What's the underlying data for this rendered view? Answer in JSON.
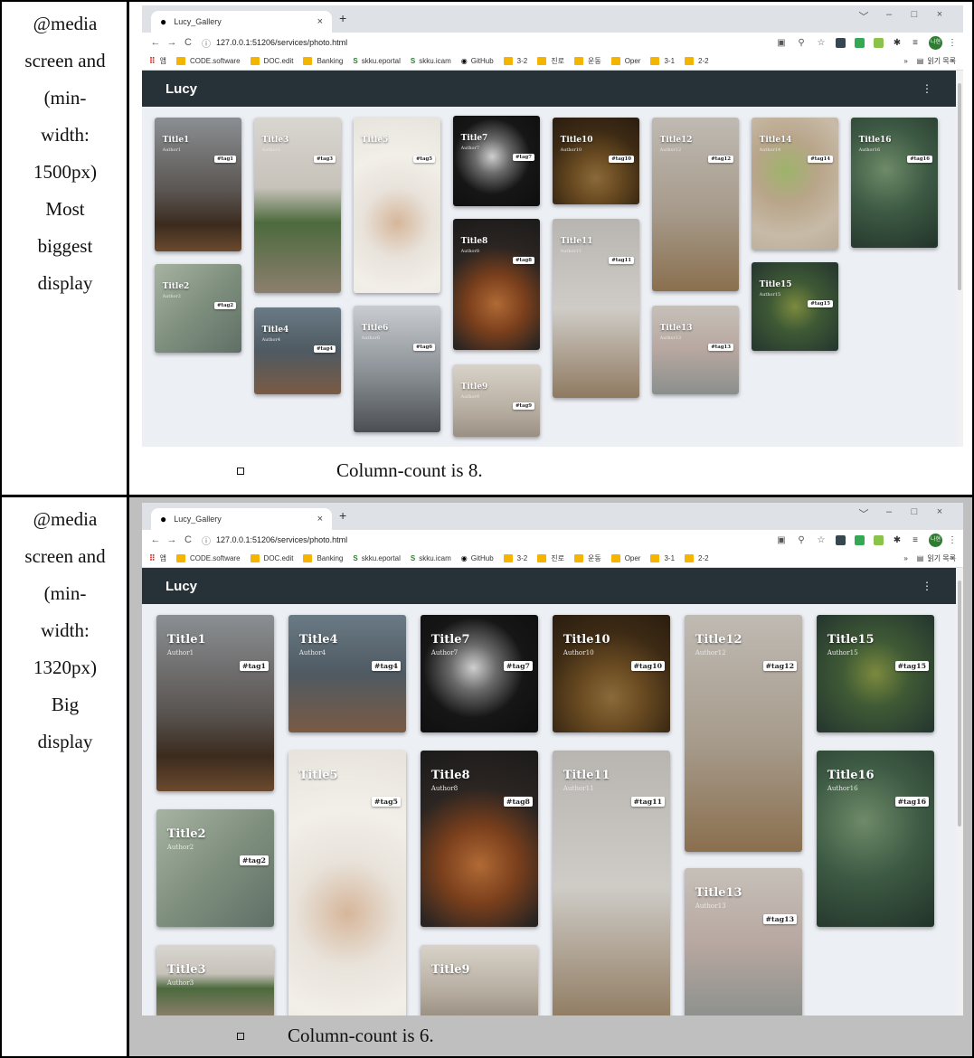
{
  "rows": [
    {
      "left_lines": [
        "@media",
        "screen and",
        "(min-",
        "width:",
        "1500px)",
        "Most",
        "biggest",
        "display"
      ],
      "caption": "Column-count is 8."
    },
    {
      "left_lines": [
        "@media",
        "screen and",
        "(min-",
        "width:",
        "1320px)",
        "Big",
        "display"
      ],
      "caption": "Column-count is 6."
    }
  ],
  "browser": {
    "tab_title": "Lucy_Gallery",
    "tab_close": "×",
    "new_tab": "+",
    "url": "127.0.0.1:51206/services/photo.html",
    "window_controls": [
      "﹀",
      "–",
      "□",
      "×"
    ],
    "bookmarks": [
      {
        "label": "앱",
        "type": "apps"
      },
      {
        "label": "CODE.software",
        "type": "folder"
      },
      {
        "label": "DOC.edit",
        "type": "folder"
      },
      {
        "label": "Banking",
        "type": "folder"
      },
      {
        "label": "skku.eportal",
        "type": "site"
      },
      {
        "label": "skku.icam",
        "type": "site"
      },
      {
        "label": "GitHub",
        "type": "github"
      },
      {
        "label": "3-2",
        "type": "folder"
      },
      {
        "label": "진로",
        "type": "folder"
      },
      {
        "label": "운동",
        "type": "folder"
      },
      {
        "label": "Oper",
        "type": "folder"
      },
      {
        "label": "3-1",
        "type": "folder"
      },
      {
        "label": "2-2",
        "type": "folder"
      }
    ],
    "bookmarks_more": "»",
    "reading_list": "읽기 목록",
    "profile": "나현",
    "app_brand": "Lucy",
    "app_menu": "⋮"
  },
  "colors": {
    "appbar": "#263238",
    "gallery_bg": "#eceff4",
    "folder": "#f4b400",
    "profile": "#2e7d32",
    "second_row_bg": "#bfbfbf"
  },
  "cards_top": [
    {
      "title": "Title1",
      "author": "Author1",
      "tag": "#tag1",
      "bg": "linear-gradient(180deg,#8b8f93 0%,#5a5552 55%,#3b2b1e 80%,#6b4a2e 100%)"
    },
    {
      "title": "Title2",
      "author": "Author2",
      "tag": "#tag2",
      "bg": "linear-gradient(135deg,#a7b3a2 0%,#7f8f7e 50%,#5f6f66 100%)"
    },
    {
      "title": "Title3",
      "author": "Author3",
      "tag": "#tag3",
      "bg": "linear-gradient(180deg,#d9d6d0 0%,#c7c2ba 40%,#4c6a3d 60%,#8c7f6e 100%)"
    },
    {
      "title": "Title4",
      "author": "Author4",
      "tag": "#tag4",
      "bg": "linear-gradient(180deg,#6a7a86 0%,#4f5a62 50%,#7a5a44 100%)"
    },
    {
      "title": "Title5",
      "author": "Author5",
      "tag": "#tag5",
      "bg": "radial-gradient(circle at 50% 60%,#d6b69a 0%,#e8e2da 30%,#f2efe9 60%,#e7e3dc 100%)"
    },
    {
      "title": "Title6",
      "author": "Author6",
      "tag": "#tag6",
      "bg": "linear-gradient(180deg,#c9ccd0 0%,#8e9499 50%,#4c4f52 100%)"
    },
    {
      "title": "Title7",
      "author": "Author7",
      "tag": "#tag7",
      "bg": "radial-gradient(circle at 45% 45%,#cfcfcf 0%,#6b6b6b 25%,#161616 55%,#0e0e0e 100%)"
    },
    {
      "title": "Title8",
      "author": "Author8",
      "tag": "#tag8",
      "bg": "radial-gradient(circle at 50% 65%,#b06a35 0%,#7a3f1c 30%,#2b2522 60%,#1b1a1a 100%)"
    },
    {
      "title": "Title9",
      "author": "Author9",
      "tag": "#tag9",
      "bg": "linear-gradient(180deg,#d8d2c8 0%,#b9b0a4 60%,#9a8f82 100%)"
    },
    {
      "title": "Title10",
      "author": "Author10",
      "tag": "#tag10",
      "bg": "radial-gradient(circle at 50% 70%,#8a6a3a 0%,#6b4c22 30%,#3c2a14 65%,#2a1d10 100%)"
    },
    {
      "title": "Title11",
      "author": "Author11",
      "tag": "#tag11",
      "bg": "linear-gradient(180deg,#b8b5b1 0%,#cfccc7 50%,#8f7a60 100%)"
    },
    {
      "title": "Title12",
      "author": "Author12",
      "tag": "#tag12",
      "bg": "linear-gradient(180deg,#bfbab3 0%,#a69a8a 55%,#8a6f4e 100%)"
    },
    {
      "title": "Title13",
      "author": "Author13",
      "tag": "#tag13",
      "bg": "linear-gradient(180deg,#c6c0b9 0%,#b7a7a0 50%,#8a8f8c 100%)"
    },
    {
      "title": "Title14",
      "author": "Author14",
      "tag": "#tag14",
      "bg": "radial-gradient(circle at 40% 40%,#9db36a 0%,#b9a58a 35%,#c7bba8 70%,#b9ad99 100%)"
    },
    {
      "title": "Title15",
      "author": "Author15",
      "tag": "#tag15",
      "bg": "radial-gradient(circle at 50% 50%,#7c8a3e 0%,#3f5a35 40%,#24352f 100%)"
    },
    {
      "title": "Title16",
      "author": "Author16",
      "tag": "#tag16",
      "bg": "radial-gradient(circle at 40% 40%,#6e8a68 0%,#3d5a44 45%,#223329 100%)"
    }
  ],
  "cards_bottom": [
    {
      "title": "Title1",
      "author": "Author1",
      "tag": "#tag1"
    },
    {
      "title": "Title2",
      "author": "Author2",
      "tag": "#tag2"
    },
    {
      "title": "Title3",
      "author": "Author3",
      "tag": ""
    },
    {
      "title": "Title4",
      "author": "Author4",
      "tag": "#tag4"
    },
    {
      "title": "Title5",
      "author": "Author5",
      "tag": "#tag5"
    },
    {
      "title": "Title7",
      "author": "Author7",
      "tag": "#tag7"
    },
    {
      "title": "Title8",
      "author": "Author8",
      "tag": "#tag8"
    },
    {
      "title": "Title9",
      "author": "",
      "tag": ""
    },
    {
      "title": "Title10",
      "author": "Author10",
      "tag": "#tag10"
    },
    {
      "title": "Title11",
      "author": "Author11",
      "tag": "#tag11"
    },
    {
      "title": "Title12",
      "author": "Author12",
      "tag": "#tag12"
    },
    {
      "title": "Title13",
      "author": "Author13",
      "tag": "#tag13"
    },
    {
      "title": "Title15",
      "author": "Author15",
      "tag": "#tag15"
    },
    {
      "title": "Title16",
      "author": "Author16",
      "tag": "#tag16"
    }
  ]
}
